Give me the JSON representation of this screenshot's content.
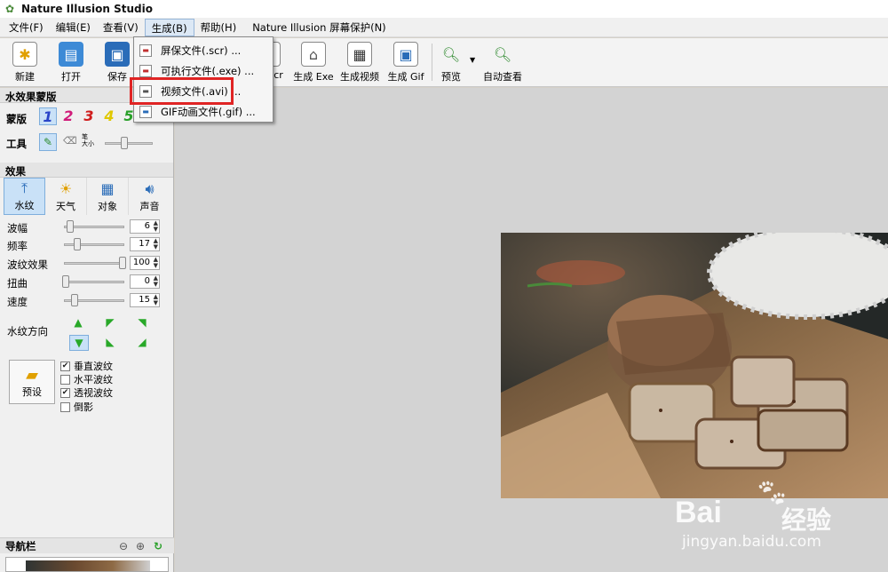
{
  "window": {
    "title": "Nature Illusion Studio"
  },
  "menu": [
    {
      "label": "文件(F)"
    },
    {
      "label": "编辑(E)"
    },
    {
      "label": "查看(V)"
    },
    {
      "label": "生成(B)"
    },
    {
      "label": "帮助(H)"
    },
    {
      "label": "Nature Illusion 屏幕保护(N)"
    }
  ],
  "toolbar": {
    "new": "新建",
    "open": "打开",
    "save": "保存",
    "gen_scr": "Scr",
    "gen_exe": "生成 Exe",
    "gen_video": "生成视频",
    "gen_gif": "生成 Gif",
    "preview": "预览",
    "auto_view": "自动查看"
  },
  "generate_menu": {
    "items": [
      {
        "label": "屏保文件(.scr) ..."
      },
      {
        "label": "可执行文件(.exe) ..."
      },
      {
        "label": "视频文件(.avi) ..."
      },
      {
        "label": "GIF动画文件(.gif) ..."
      }
    ]
  },
  "water_mask": {
    "title": "水效果蒙版",
    "mask_label": "蒙版",
    "masks": [
      "1",
      "2",
      "3",
      "4",
      "5"
    ],
    "tool_label": "工具",
    "brush_size_label": "笔\n大小",
    "brush_size": 0.39
  },
  "effects": {
    "title": "效果",
    "tabs": [
      {
        "label": "水纹"
      },
      {
        "label": "天气"
      },
      {
        "label": "对象"
      },
      {
        "label": "声音"
      }
    ],
    "params": [
      {
        "label": "波幅",
        "value": "6",
        "pos": 0.08
      },
      {
        "label": "频率",
        "value": "17",
        "pos": 0.2
      },
      {
        "label": "波纹效果",
        "value": "100",
        "pos": 1.0
      },
      {
        "label": "扭曲",
        "value": "0",
        "pos": 0.0
      },
      {
        "label": "速度",
        "value": "15",
        "pos": 0.15
      }
    ],
    "direction_label": "水纹方向",
    "preset_label": "预设",
    "checkboxes": [
      {
        "label": "垂直波纹",
        "checked": true
      },
      {
        "label": "水平波纹",
        "checked": false
      },
      {
        "label": "透视波纹",
        "checked": true
      },
      {
        "label": "倒影",
        "checked": false
      }
    ]
  },
  "navigator": {
    "title": "导航栏"
  },
  "watermark": {
    "brand": "Bai",
    "brand2": "经验",
    "url": "jingyan.baidu.com"
  },
  "colors": {
    "highlight": "#e02424",
    "selected_bg": "#c9e1f7",
    "canvas_bg": "#d3d3d3"
  }
}
